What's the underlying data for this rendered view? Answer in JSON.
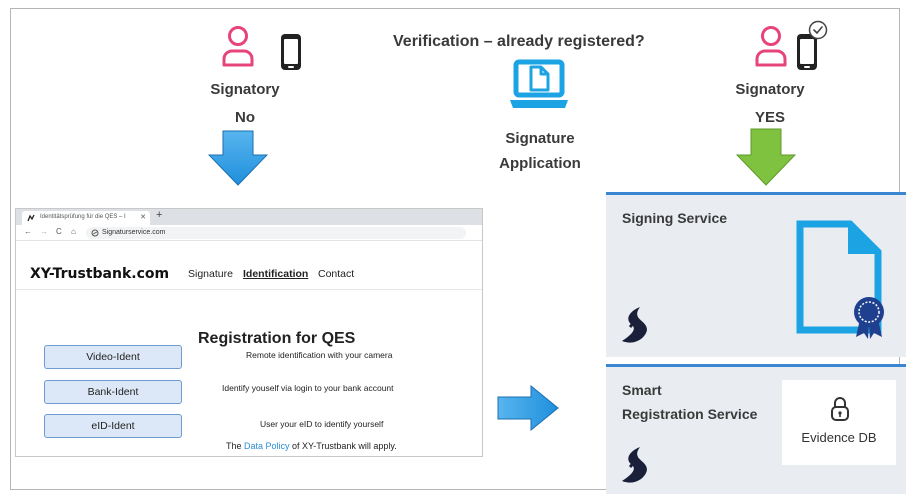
{
  "header": {
    "question": "Verification – already registered?"
  },
  "left_signatory": {
    "label": "Signatory",
    "answer": "No"
  },
  "right_signatory": {
    "label": "Signatory",
    "answer": "YES"
  },
  "application": {
    "line1": "Signature",
    "line2": "Application"
  },
  "browser": {
    "tab_title": "Identitätsprüfung für die QES – I",
    "url": "Signaturservice.com",
    "logo": "XY-Trustbank.com",
    "nav": [
      "Signature",
      "Identification",
      "Contact"
    ],
    "active_nav": "Identification",
    "registration_title": "Registration for QES",
    "methods": [
      {
        "button": "Video-Ident",
        "description": "Remote identification with your camera"
      },
      {
        "button": "Bank-Ident",
        "description": "Identify youself via login to your bank account"
      },
      {
        "button": "eID-Ident",
        "description": "User your eID to identify yourself"
      }
    ],
    "policy": {
      "prefix": "The ",
      "link": "Data Policy",
      "suffix": " of XY-Trustbank will apply."
    }
  },
  "panels": {
    "signing_service": {
      "title": "Signing Service"
    },
    "smart_registration": {
      "title_line1": "Smart",
      "title_line2": "Registration Service"
    },
    "evidence_db": {
      "label": "Evidence DB"
    }
  },
  "colors": {
    "person_icon": "#e6447a",
    "arrow_blue": "#2f9be3",
    "arrow_green": "#7ec23f",
    "app_icon": "#1ca3e3",
    "document_icon": "#1ca3e3",
    "panel_bg": "#e9edf2",
    "panel_border": "#3a86d1",
    "seal": "#1f3f8f"
  }
}
